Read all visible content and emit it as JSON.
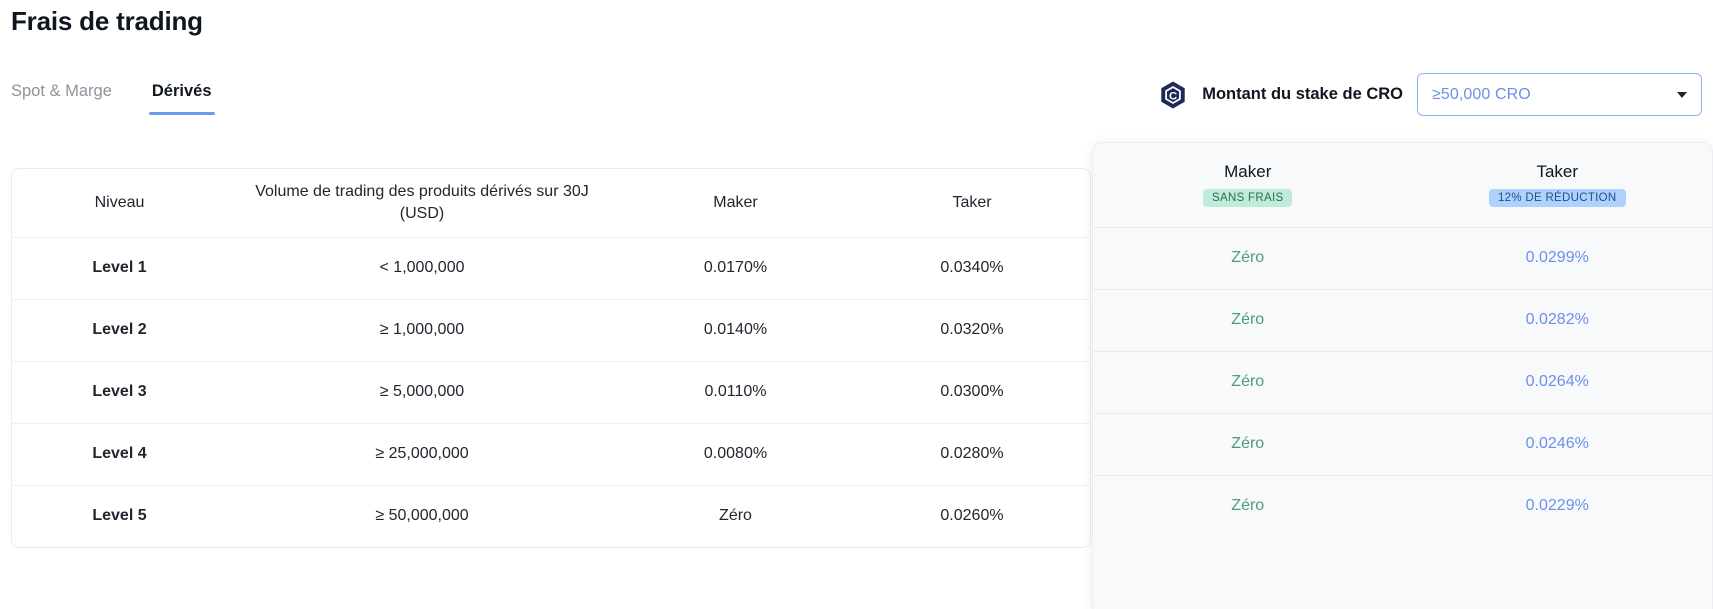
{
  "header": {
    "title": "Frais de trading"
  },
  "tabs": [
    {
      "label": "Spot & Marge",
      "active": false
    },
    {
      "label": "Dérivés",
      "active": true
    }
  ],
  "stake": {
    "icon": "cro-hexagon-icon",
    "label": "Montant du stake de CRO",
    "selected_value": "≥50,000 CRO",
    "caret_icon": "chevron-down-icon"
  },
  "table": {
    "columns": [
      "Niveau",
      "Volume de trading des produits dérivés sur 30J (USD)",
      "Maker",
      "Taker"
    ],
    "column_volume_line1": "Volume de trading des produits dérivés sur 30J",
    "column_volume_line2": "(USD)",
    "rows": [
      {
        "level": "Level 1",
        "volume": "< 1,000,000",
        "maker": "0.0170%",
        "taker": "0.0340%",
        "maker_zero": false
      },
      {
        "level": "Level 2",
        "volume": "≥ 1,000,000",
        "maker": "0.0140%",
        "taker": "0.0320%",
        "maker_zero": false
      },
      {
        "level": "Level 3",
        "volume": "≥ 5,000,000",
        "maker": "0.0110%",
        "taker": "0.0300%",
        "maker_zero": false
      },
      {
        "level": "Level 4",
        "volume": "≥ 25,000,000",
        "maker": "0.0080%",
        "taker": "0.0280%",
        "maker_zero": false
      },
      {
        "level": "Level 5",
        "volume": "≥ 50,000,000",
        "maker": "Zéro",
        "taker": "0.0260%",
        "maker_zero": true
      }
    ]
  },
  "promo": {
    "maker_header": "Maker",
    "maker_badge": "SANS FRAIS",
    "taker_header": "Taker",
    "taker_badge": "12% DE RÉDUCTION",
    "rows": [
      {
        "maker": "Zéro",
        "taker": "0.0299%"
      },
      {
        "maker": "Zéro",
        "taker": "0.0282%"
      },
      {
        "maker": "Zéro",
        "taker": "0.0264%"
      },
      {
        "maker": "Zéro",
        "taker": "0.0246%"
      },
      {
        "maker": "Zéro",
        "taker": "0.0229%"
      }
    ]
  },
  "colors": {
    "accent_blue": "#6d8fe8",
    "tab_underline": "#6d9ae8",
    "zero_green": "#4f9b7e",
    "badge_green_bg": "#bfecd9",
    "badge_blue_bg": "#aed2fb",
    "panel_bg": "#f7f9fb",
    "text_primary": "#10161f"
  }
}
